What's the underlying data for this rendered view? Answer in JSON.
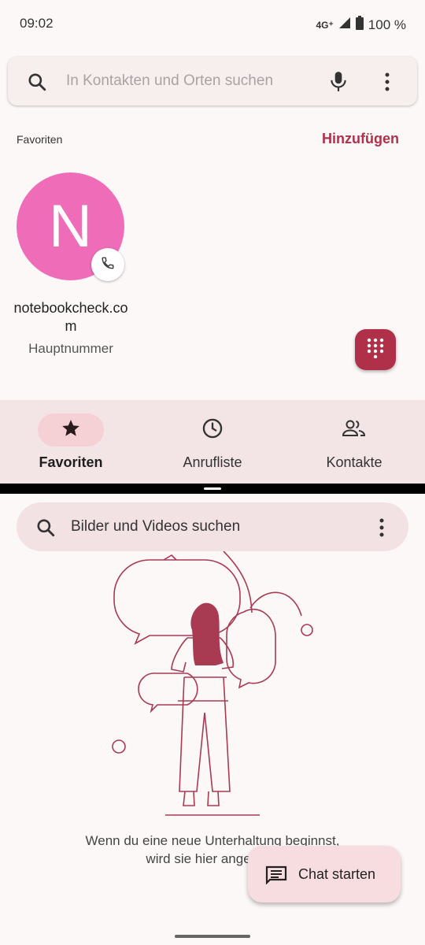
{
  "status_bar": {
    "time": "09:02",
    "network": "4G⁺",
    "battery": "100 %",
    "icons": [
      "signal-icon",
      "battery-icon"
    ]
  },
  "contacts": {
    "search_placeholder": "In Kontakten und Orten suchen",
    "favorites_header": "Favoriten",
    "add_label": "Hinzufügen",
    "favorite": {
      "initial": "N",
      "name": "notebookcheck.co m",
      "number_type": "Hauptnummer",
      "avatar_color": "#ef6db8"
    },
    "accent_color": "#b0304a"
  },
  "bottom_nav": {
    "items": [
      {
        "label": "Favoriten",
        "icon": "star-icon",
        "active": true
      },
      {
        "label": "Anrufliste",
        "icon": "clock-icon",
        "active": false
      },
      {
        "label": "Kontakte",
        "icon": "people-icon",
        "active": false
      }
    ]
  },
  "messages": {
    "search_placeholder": "Bilder und Videos suchen",
    "empty_text_line1": "Wenn du eine neue Unterhaltung beginnst,",
    "empty_text_line2": "wird sie hier angezeigt",
    "fab_label": "Chat starten"
  }
}
